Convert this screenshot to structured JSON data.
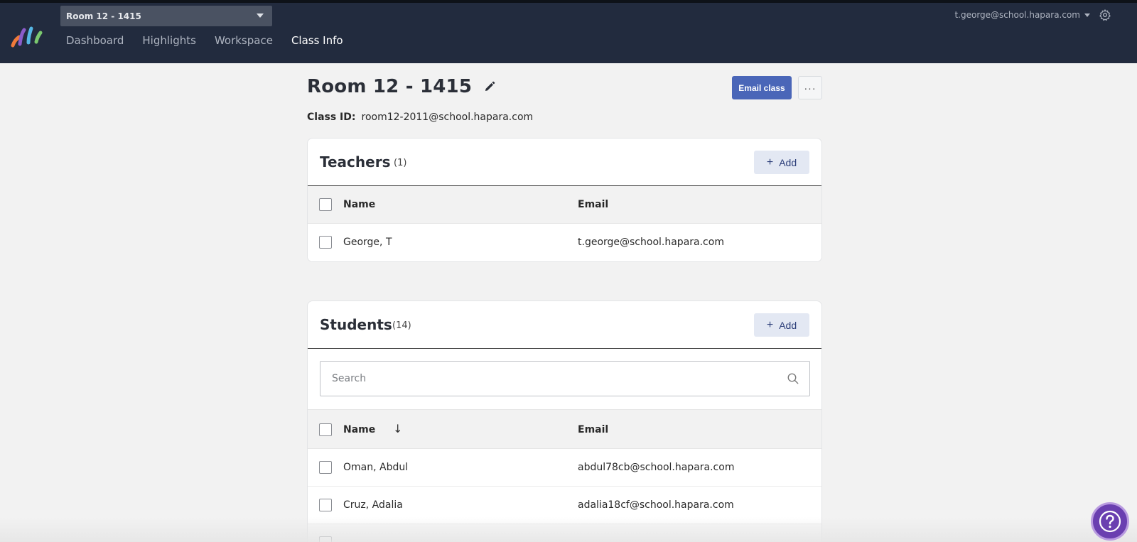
{
  "topbar": {
    "class_select": "Room 12 - 1415",
    "nav": [
      "Dashboard",
      "Highlights",
      "Workspace",
      "Class Info"
    ],
    "active_nav": "Class Info",
    "account_email": "t.george@school.hapara.com",
    "icons": {
      "logo": "hapara-logo",
      "settings": "gear-icon",
      "dropdown": "chevron-down-icon"
    }
  },
  "page": {
    "title": "Room 12 - 1415",
    "email_class_label": "Email class",
    "more_label": "···",
    "class_id_label": "Class ID:",
    "class_id_value": "room12-2011@school.hapara.com"
  },
  "teachers": {
    "title": "Teachers",
    "count": "(1)",
    "add_label": "Add",
    "columns": {
      "name": "Name",
      "email": "Email"
    },
    "rows": [
      {
        "name": "George, T",
        "email": "t.george@school.hapara.com"
      }
    ]
  },
  "students": {
    "title": "Students",
    "count": "(14)",
    "add_label": "Add",
    "search_placeholder": "Search",
    "columns": {
      "name": "Name",
      "email": "Email"
    },
    "sort_glyph": "↓",
    "rows": [
      {
        "name": "Oman, Abdul",
        "email": "abdul78cb@school.hapara.com"
      },
      {
        "name": "Cruz, Adalia",
        "email": "adalia18cf@school.hapara.com"
      }
    ]
  },
  "colors": {
    "topbar_bg": "#222b3e",
    "primary_button": "#4a66b8",
    "add_button_bg": "#e3e8f3",
    "help_button": "#6a3fb0"
  }
}
